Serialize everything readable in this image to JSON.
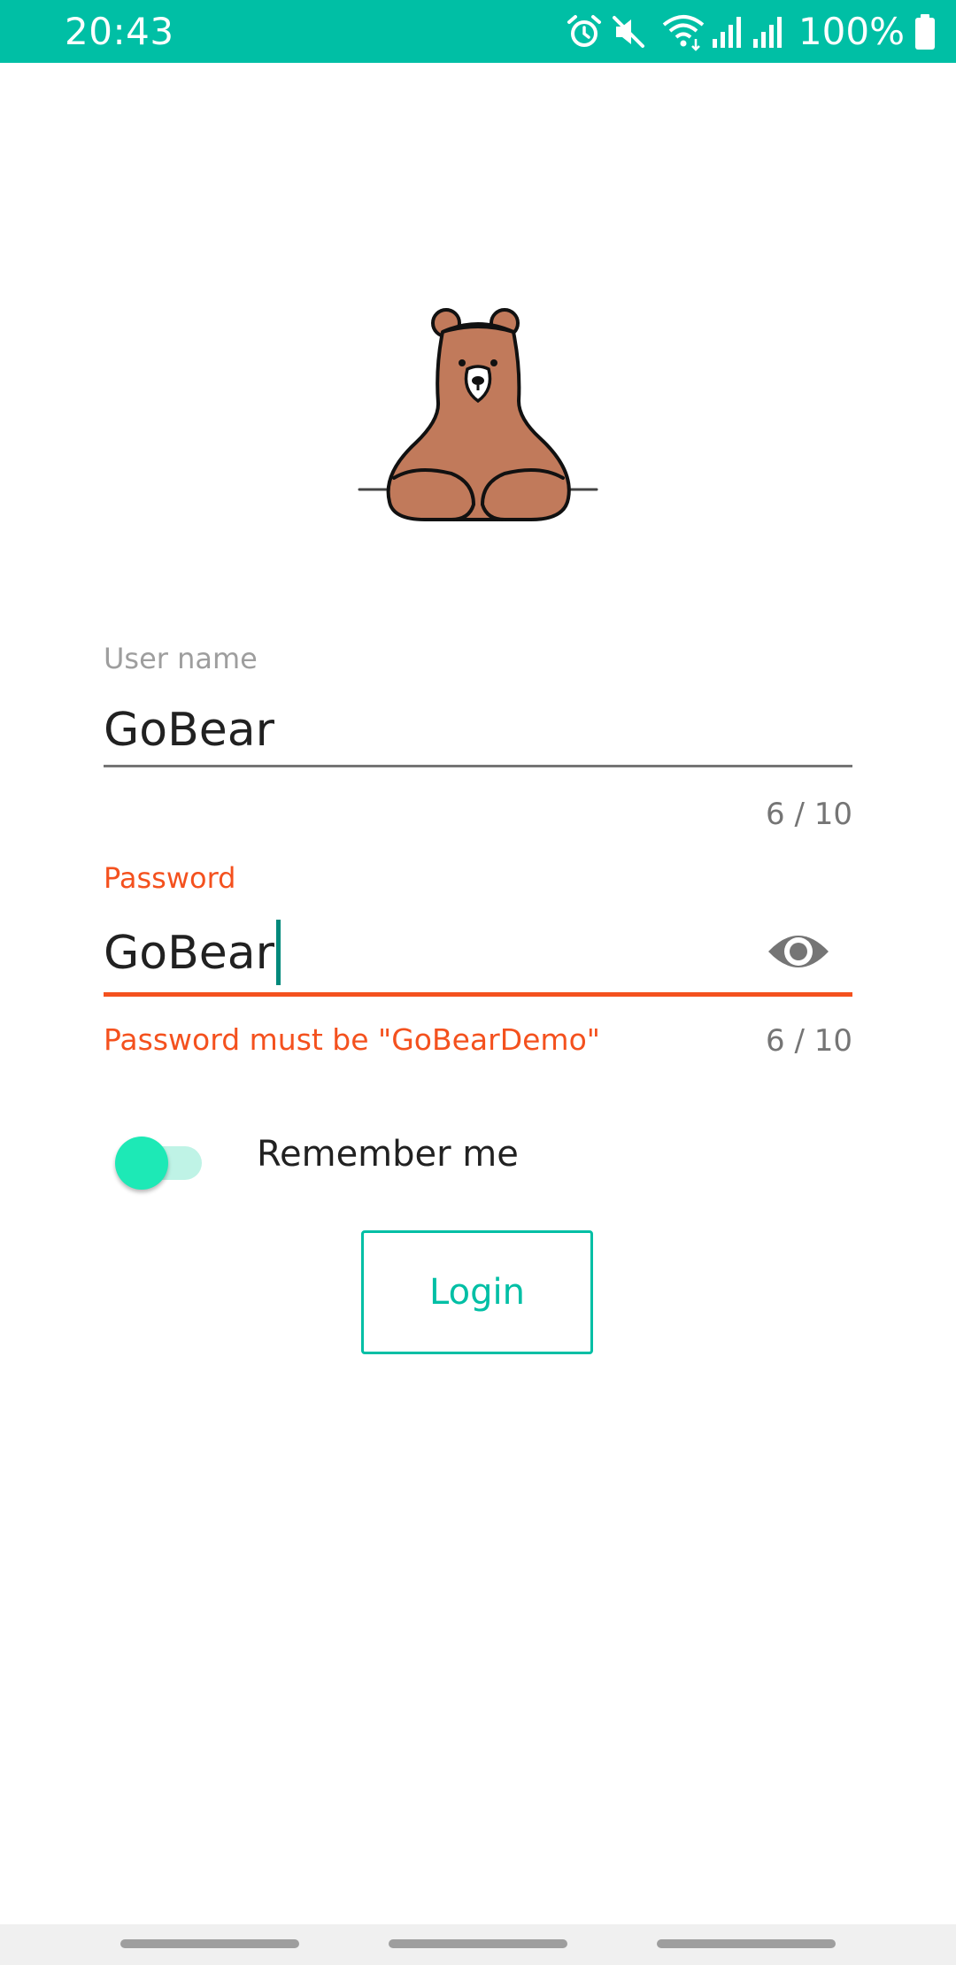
{
  "status_bar": {
    "time": "20:43",
    "battery_text": "100%",
    "icons": [
      "alarm-icon",
      "mute-icon",
      "wifi-icon",
      "signal-icon",
      "signal-icon",
      "battery-icon"
    ],
    "background_color": "#00bfa5"
  },
  "logo": {
    "icon": "bear-logo"
  },
  "username": {
    "label": "User name",
    "value": "GoBear",
    "counter": "6 / 10"
  },
  "password": {
    "label": "Password",
    "value": "GoBear",
    "error": "Password must be \"GoBearDemo\"",
    "counter": "6 / 10",
    "toggle_icon": "eye-icon",
    "error_color": "#f4511e"
  },
  "remember": {
    "label": "Remember me",
    "checked": true
  },
  "login_button": {
    "label": "Login",
    "accent_color": "#00bfa5"
  }
}
